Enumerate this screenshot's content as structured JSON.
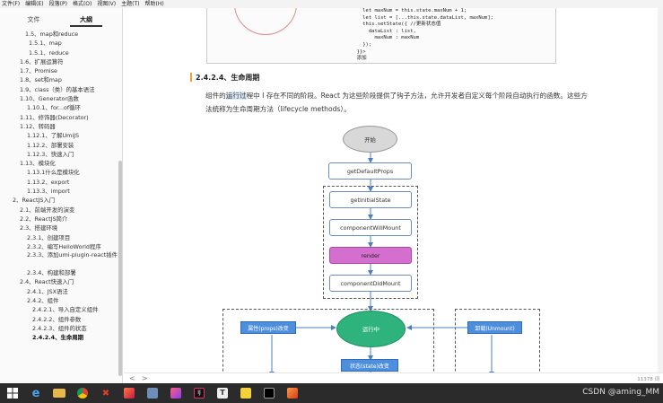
{
  "menubar": [
    "文件(F)",
    "编辑(E)",
    "段落(P)",
    "格式(O)",
    "视图(V)",
    "主题(T)",
    "帮助(H)"
  ],
  "sidebar": {
    "tabs": [
      "文件",
      "大纲"
    ],
    "items": [
      {
        "label": "1.5、map和reduce",
        "indent": 28
      },
      {
        "label": "1.5.1、map",
        "indent": 32
      },
      {
        "label": "1.5.1、reduce",
        "indent": 32
      },
      {
        "label": "1.6、扩展运算符",
        "indent": 22
      },
      {
        "label": "1.7、Promise",
        "indent": 22
      },
      {
        "label": "1.8、set和map",
        "indent": 22
      },
      {
        "label": "1.9、class（类）的基本语法",
        "indent": 22
      },
      {
        "label": "1.10、Generator函数",
        "indent": 22
      },
      {
        "label": "1.10.1、for...of循环",
        "indent": 30
      },
      {
        "label": "1.11、修饰器(Decorator)",
        "indent": 22
      },
      {
        "label": "1.12、转码器",
        "indent": 22
      },
      {
        "label": "1.12.1、了解UmiJS",
        "indent": 30
      },
      {
        "label": "1.12.2、部署安装",
        "indent": 30
      },
      {
        "label": "1.12.3、快速入门",
        "indent": 30
      },
      {
        "label": "1.13、模块化",
        "indent": 22
      },
      {
        "label": "1.13.1什么是模块化",
        "indent": 30
      },
      {
        "label": "1.13.2、export",
        "indent": 30
      },
      {
        "label": "1.13.3、import",
        "indent": 30
      },
      {
        "label": "2、ReactJS入门",
        "indent": 14
      },
      {
        "label": "2.1、前端开发的演变",
        "indent": 22
      },
      {
        "label": "2.2、ReactJS简介",
        "indent": 22
      },
      {
        "label": "2.3、搭建环境",
        "indent": 22
      },
      {
        "label": "2.3.1、创建项目",
        "indent": 30
      },
      {
        "label": "2.3.2、编写HelloWorld程序",
        "indent": 30
      },
      {
        "label": "2.3.3、添加umi-plugin-react插件",
        "indent": 30,
        "multi": true
      },
      {
        "label": "2.3.4、构建和部署",
        "indent": 30
      },
      {
        "label": "2.4、React快速入门",
        "indent": 22
      },
      {
        "label": "2.4.1、JSX语法",
        "indent": 30
      },
      {
        "label": "2.4.2、组件",
        "indent": 30
      },
      {
        "label": "2.4.2.1、导入自定义组件",
        "indent": 36
      },
      {
        "label": "2.4.2.2、组件参数",
        "indent": 36
      },
      {
        "label": "2.4.2.3、组件的状态",
        "indent": 36
      },
      {
        "label": "2.4.2.4、生命周期",
        "indent": 36,
        "active": true
      }
    ]
  },
  "code": {
    "lines": [
      "    let maxNum = this.state.maxNum + 1;",
      "    let list = [...this.state.dataList, maxNum];",
      "    this.setState({ //更新状态值",
      "      dataList : list,",
      "        maxNum : maxNum",
      "    });",
      "  }}>",
      "  添加"
    ]
  },
  "heading": "2.4.2.4、生命周期",
  "paragraph": {
    "before": "组件的",
    "highlight": "运行过",
    "after": "程中 I 存在不同的阶段。React 为这些阶段提供了钩子方法，允许开发者自定义每个阶段自动执行的函数。这些方法统称为生命周期方法（lifecycle methods）。"
  },
  "diagram": {
    "start": "开始",
    "getDefaultProps": "getDefaultProps",
    "getInitialState": "getInitialState",
    "componentWillMount": "componentWillMount",
    "render": "render",
    "componentDidMount": "componentDidMount",
    "running": "运行中",
    "propsChange": "属性(props)改变",
    "stateChange": "状态(state)改变",
    "unmount": "卸载(Unmount)"
  },
  "footer": {
    "prev": "<",
    "next": ">",
    "wordcount": "11378 词"
  },
  "taskbar": {
    "icons": [
      "windows-start",
      "ie-icon",
      "folder-icon",
      "chrome-icon",
      "xmind-icon",
      "idea-icon",
      "sublime-icon",
      "terminal-icon",
      "typora-icon",
      "notes-icon",
      "cmd-icon",
      "sublime-icon-2"
    ]
  },
  "watermark": "CSDN @aming_MM"
}
